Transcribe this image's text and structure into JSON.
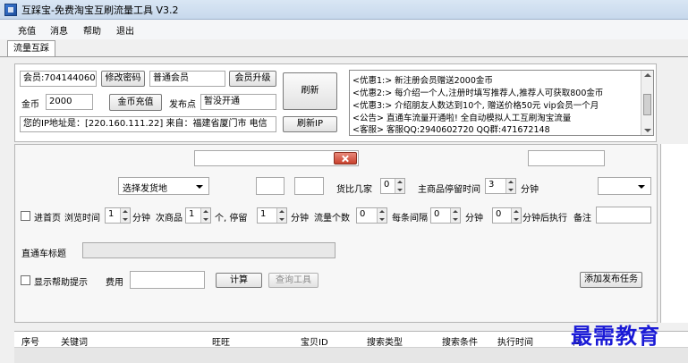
{
  "window": {
    "title": "互踩宝-免费淘宝互刷流量工具 V3.2"
  },
  "menu": [
    "充值",
    "消息",
    "帮助",
    "退出"
  ],
  "tab": {
    "label": "流量互踩"
  },
  "account": {
    "member_value": "会员:704144060",
    "change_password": "修改密码",
    "member_level": "普通会员",
    "upgrade": "会员升级",
    "gold_label": "金币",
    "gold_value": "2000",
    "gold_recharge": "金币充值",
    "publish_label": "发布点",
    "publish_value": "暂没开通",
    "refresh": "刷新",
    "ip_info": "您的IP地址是：[220.160.111.22] 来自：福建省厦门市 电信",
    "refresh_ip": "刷新IP"
  },
  "notice": [
    "<优惠1:> 新注册会员赠送2000金币",
    "<优惠2:> 每介绍一个人,注册时填写推荐人,推荐人可获取800金币",
    "<优惠3:> 介绍朋友人数达到10个, 赠送价格50元 vip会员一个月",
    "<公告> 直通车流量开通啦! 全自动模拟人工互刷淘宝流量",
    "<客服> 客服QQ:2940602720      QQ群:471672148"
  ],
  "form": {
    "ship_from": "选择发货地",
    "compare_label": "货比几家",
    "compare_value": "0",
    "main_stay_label": "主商品停留时间",
    "main_stay_value": "3",
    "minutes": "分钟",
    "homepage_label": "进首页",
    "browse_time_label": "浏览时间",
    "browse_time_value": "1",
    "minute_label": "分钟",
    "secondary_label": "次商品",
    "secondary_value": "1",
    "unit_ge": "个, 停留",
    "stay_value": "1",
    "flow_count_label": "流量个数",
    "flow_count_value": "0",
    "interval_label": "每条间隔",
    "interval_value": "0",
    "exec_value": "0",
    "exec_after": "分钟后执行",
    "remark_label": "备注",
    "ztc_title_label": "直通车标题",
    "show_help": "显示帮助提示",
    "fee_label": "费用",
    "calculate": "计算",
    "query_tool": "查询工具",
    "add_task": "添加发布任务"
  },
  "table": {
    "columns": [
      "序号",
      "关键词",
      "旺旺",
      "宝贝ID",
      "搜索类型",
      "搜索条件",
      "执行时间",
      "间"
    ]
  },
  "watermark": "最需教育"
}
